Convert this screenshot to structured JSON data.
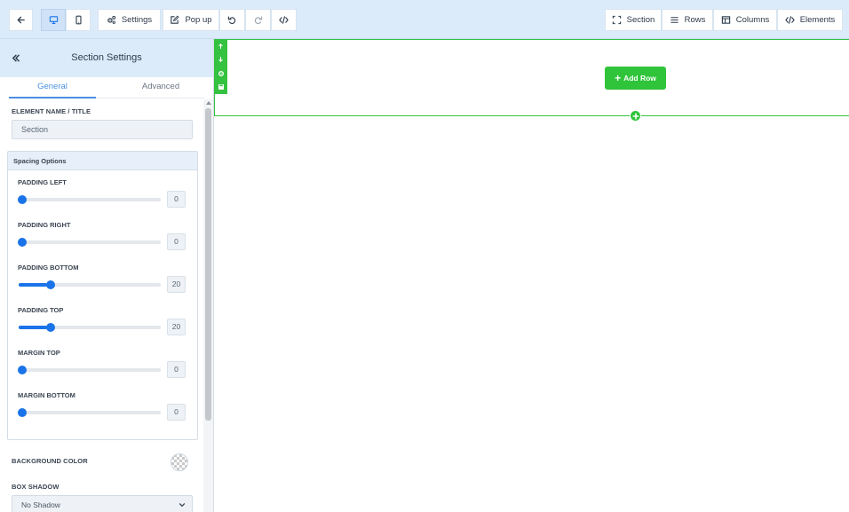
{
  "toolbar": {
    "settings_label": "Settings",
    "popup_label": "Pop up",
    "section_label": "Section",
    "rows_label": "Rows",
    "columns_label": "Columns",
    "elements_label": "Elements"
  },
  "sidebar": {
    "title": "Section Settings",
    "tabs": [
      {
        "label": "General",
        "active": true
      },
      {
        "label": "Advanced",
        "active": false
      }
    ],
    "element_name": {
      "label": "ELEMENT NAME / TITLE",
      "value": "Section"
    },
    "spacing": {
      "title": "Spacing Options",
      "sliders": [
        {
          "label": "PADDING LEFT",
          "value": "0",
          "fraction": 0.0
        },
        {
          "label": "PADDING RIGHT",
          "value": "0",
          "fraction": 0.0
        },
        {
          "label": "PADDING BOTTOM",
          "value": "20",
          "fraction": 0.2
        },
        {
          "label": "PADDING TOP",
          "value": "20",
          "fraction": 0.2
        },
        {
          "label": "MARGIN TOP",
          "value": "0",
          "fraction": 0.0
        },
        {
          "label": "MARGIN BOTTOM",
          "value": "0",
          "fraction": 0.0
        }
      ]
    },
    "background_color": {
      "label": "BACKGROUND COLOR"
    },
    "box_shadow": {
      "label": "BOX SHADOW",
      "value": "No Shadow"
    }
  },
  "canvas": {
    "add_row_label": "Add Row"
  },
  "colors": {
    "accent": "#4a90e2",
    "slider": "#1a73e8",
    "section_green": "#34c240",
    "toolbar_bg": "#dcebfa"
  }
}
